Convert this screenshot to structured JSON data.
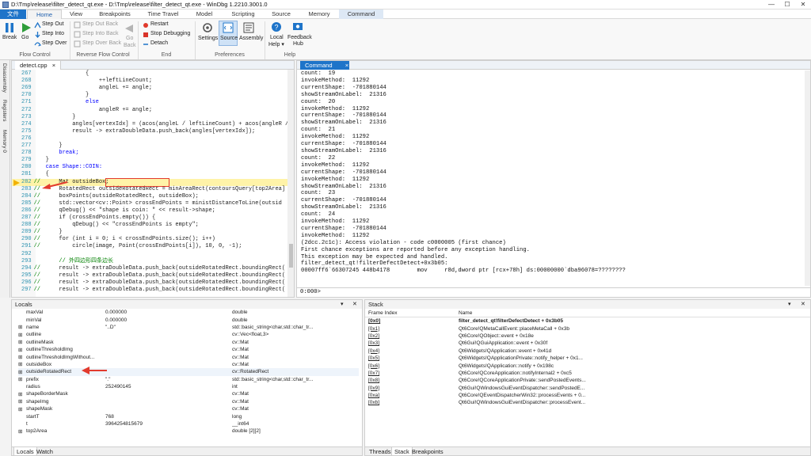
{
  "window": {
    "title": "D:\\Tmp\\release\\filter_detect_qt.exe - D:\\Tmp\\release\\filter_detect_qt.exe - WinDbg 1.2210.3001.0",
    "minimize": "—",
    "maximize": "☐",
    "close": "✕"
  },
  "menu": {
    "tabs": [
      "文件",
      "Home",
      "View",
      "Breakpoints",
      "Time Travel",
      "Model",
      "Scripting",
      "Source",
      "Memory",
      "Command"
    ]
  },
  "ribbon": {
    "flow": {
      "break": "Break",
      "go": "Go",
      "step_out": "Step Out",
      "step_into": "Step Into",
      "step_over": "Step Over",
      "group": "Flow Control"
    },
    "reverse": {
      "step_out_back": "Step Out Back",
      "step_into_back": "Step Into Back",
      "step_over_back": "Step Over Back",
      "go_back_1": "Go",
      "go_back_2": "Back",
      "group": "Reverse Flow Control"
    },
    "end": {
      "restart": "Restart",
      "stop": "Stop Debugging",
      "detach": "Detach",
      "group": "End"
    },
    "prefs": {
      "settings": "Settings",
      "source": "Source",
      "assembly": "Assembly",
      "group": "Preferences"
    },
    "help": {
      "local_help": "Local",
      "local_help2": "Help ▾",
      "feedback": "Feedback",
      "feedback2": "Hub",
      "group": "Help"
    }
  },
  "side_tabs": [
    "Disassembly",
    "Registers",
    "Memory 0"
  ],
  "source": {
    "tab": "detect.cpp",
    "lines": [
      {
        "n": "267",
        "m": "",
        "t": "            {"
      },
      {
        "n": "268",
        "m": "",
        "t": "                ++leftLineCount;"
      },
      {
        "n": "269",
        "m": "",
        "t": "                angleL += angle;"
      },
      {
        "n": "270",
        "m": "",
        "t": "            }"
      },
      {
        "n": "271",
        "m": "",
        "t": "            else"
      },
      {
        "n": "272",
        "m": "",
        "t": "                angleR += angle;"
      },
      {
        "n": "273",
        "m": "",
        "t": "        }"
      },
      {
        "n": "274",
        "m": "",
        "t": "        angles[vertexIdx] = (acos(angleL / leftLineCount) + acos(angleR /"
      },
      {
        "n": "275",
        "m": "",
        "t": "        result -> extraDoubleData.push_back(angles[vertexIdx]);"
      },
      {
        "n": "276",
        "m": "",
        "t": ""
      },
      {
        "n": "277",
        "m": "",
        "t": "    }"
      },
      {
        "n": "278",
        "m": "",
        "t": "    break;"
      },
      {
        "n": "279",
        "m": "",
        "t": "}"
      },
      {
        "n": "280",
        "m": "",
        "t": "case Shape::COIN:"
      },
      {
        "n": "281",
        "m": "",
        "t": "{"
      },
      {
        "n": "282",
        "m": "//",
        "t": "    Mat outsideBox;"
      },
      {
        "n": "283",
        "m": "//",
        "t": "    RotatedRect outsideRotatedRect = minAreaRect(contoursQuery[top2Area]"
      },
      {
        "n": "284",
        "m": "//",
        "t": "    boxPoints(outsideRotatedRect, outsideBox);"
      },
      {
        "n": "285",
        "m": "//",
        "t": "    std::vector<cv::Point> crossEndPoints = ministDistanceToLine(outsid"
      },
      {
        "n": "286",
        "m": "//",
        "t": "    qDebug() << \"shape is coin: \" << result->shape;"
      },
      {
        "n": "287",
        "m": "//",
        "t": "    if (crossEndPoints.empty()) {"
      },
      {
        "n": "288",
        "m": "//",
        "t": "        qDebug() << \"crossEndPoints is empty\";"
      },
      {
        "n": "289",
        "m": "//",
        "t": "    }"
      },
      {
        "n": "290",
        "m": "//",
        "t": "    for (int i = 0; i < crossEndPoints.size(); i++)"
      },
      {
        "n": "291",
        "m": "//",
        "t": "        circle(image, Point(crossEndPoints[i]), 10, 0, -1);"
      },
      {
        "n": "292",
        "m": "",
        "t": ""
      },
      {
        "n": "293",
        "m": "",
        "t": "    // 外四边形四条边长"
      },
      {
        "n": "294",
        "m": "//",
        "t": "    result -> extraDoubleData.push_back(outsideRotatedRect.boundingRect("
      },
      {
        "n": "295",
        "m": "//",
        "t": "    result -> extraDoubleData.push_back(outsideRotatedRect.boundingRect("
      },
      {
        "n": "296",
        "m": "//",
        "t": "    result -> extraDoubleData.push_back(outsideRotatedRect.boundingRect("
      },
      {
        "n": "297",
        "m": "//",
        "t": "    result -> extraDoubleData.push_back(outsideRotatedRect.boundingRect("
      }
    ]
  },
  "command": {
    "tab": "Command",
    "output": [
      "count:  19",
      "invokeMethod:  11292",
      "currentShape:  -701880144",
      "showStreamOnLabel:  21316",
      "count:  20",
      "invokeMethod:  11292",
      "currentShape:  -701880144",
      "showStreamOnLabel:  21316",
      "count:  21",
      "invokeMethod:  11292",
      "currentShape:  -701880144",
      "showStreamOnLabel:  21316",
      "count:  22",
      "invokeMethod:  11292",
      "currentShape:  -701880144",
      "invokeMethod:  11292",
      "showStreamOnLabel:  21316",
      "count:  23",
      "currentShape:  -701880144",
      "showStreamOnLabel:  21316",
      "count:  24",
      "invokeMethod:  11292",
      "currentShape:  -701880144",
      "invokeMethod:  11292",
      "(2dcc.2c1c): Access violation - code c0000005 (first chance)",
      "First chance exceptions are reported before any exception handling.",
      "This exception may be expected and handled.",
      "filter_detect_qt!filterDefectDetect+0x3b05:",
      "00007ff6`66307245 448b4178        mov     r8d,dword ptr [rcx+78h] ds:00000000`dba96078=????????"
    ],
    "prompt": "0:000>"
  },
  "locals": {
    "title": "Locals",
    "rows": [
      {
        "exp": "",
        "name": "maxVal",
        "value": "0.000000",
        "type": "double"
      },
      {
        "exp": "",
        "name": "minVal",
        "value": "0.000000",
        "type": "double"
      },
      {
        "exp": "⊞",
        "name": "name",
        "value": "\"..D\"",
        "type": "std::basic_string<char,std::char_tr..."
      },
      {
        "exp": "⊞",
        "name": "outline",
        "value": "",
        "type": "cv::Vec<float,3>"
      },
      {
        "exp": "⊞",
        "name": "outlineMask",
        "value": "",
        "type": "cv::Mat"
      },
      {
        "exp": "⊞",
        "name": "outlineThresholdImg",
        "value": "",
        "type": "cv::Mat"
      },
      {
        "exp": "⊞",
        "name": "outlineThresholdImgWithout...",
        "value": "",
        "type": "cv::Mat"
      },
      {
        "exp": "⊞",
        "name": "outsideBox",
        "value": "",
        "type": "cv::Mat"
      },
      {
        "exp": "⊞",
        "name": "outsideRotatedRect",
        "value": "",
        "type": "cv::RotatedRect"
      },
      {
        "exp": "⊞",
        "name": "prefix",
        "value": "\".\"",
        "type": "std::basic_string<char,std::char_tr..."
      },
      {
        "exp": "",
        "name": "radius",
        "value": "252490145",
        "type": "int"
      },
      {
        "exp": "⊞",
        "name": "shapeBorderMask",
        "value": "",
        "type": "cv::Mat"
      },
      {
        "exp": "⊞",
        "name": "shapeImg",
        "value": "",
        "type": "cv::Mat"
      },
      {
        "exp": "⊞",
        "name": "shapeMask",
        "value": "",
        "type": "cv::Mat"
      },
      {
        "exp": "",
        "name": "startT",
        "value": "768",
        "type": "long"
      },
      {
        "exp": "",
        "name": "t",
        "value": "3964254815679",
        "type": "__int64"
      },
      {
        "exp": "⊞",
        "name": "top2Area",
        "value": "",
        "type": "double [2][2]"
      }
    ],
    "bottom_tabs": [
      "Locals",
      "Watch"
    ]
  },
  "stack": {
    "title": "Stack",
    "headers": [
      "Frame Index",
      "Name"
    ],
    "rows": [
      {
        "idx": "[0x0]",
        "name": "filter_detect_qt!filterDefectDetect + 0x3b05"
      },
      {
        "idx": "[0x1]",
        "name": "Qt6Core!QMetaCallEvent::placeMetaCall + 0x3b"
      },
      {
        "idx": "[0x2]",
        "name": "Qt6Core!QObject::event + 0x18e"
      },
      {
        "idx": "[0x3]",
        "name": "Qt6Gui!QGuiApplication::event + 0x30f"
      },
      {
        "idx": "[0x4]",
        "name": "Qt6Widgets!QApplication::event + 0x41d"
      },
      {
        "idx": "[0x5]",
        "name": "Qt6Widgets!QApplicationPrivate::notify_helper + 0x1..."
      },
      {
        "idx": "[0x6]",
        "name": "Qt6Widgets!QApplication::notify + 0x198c"
      },
      {
        "idx": "[0x7]",
        "name": "Qt6Core!QCoreApplication::notifyInternal2 + 0xc5"
      },
      {
        "idx": "[0x8]",
        "name": "Qt6Core!QCoreApplicationPrivate::sendPostedEvents..."
      },
      {
        "idx": "[0x9]",
        "name": "Qt6Gui!QWindowsGuiEventDispatcher::sendPostedE..."
      },
      {
        "idx": "[0xa]",
        "name": "Qt6Core!QEventDispatcherWin32::processEvents + 0..."
      },
      {
        "idx": "[0xb]",
        "name": "Qt6Gui!QWindowsGuiEventDispatcher::processEvent..."
      }
    ],
    "bottom_tabs": [
      "Threads",
      "Stack",
      "Breakpoints"
    ]
  },
  "colors": {
    "accent": "#1e74c9",
    "command_tab": "#1e74c9",
    "current_line": "#fff3a8",
    "arrow": "#e23b2e"
  }
}
